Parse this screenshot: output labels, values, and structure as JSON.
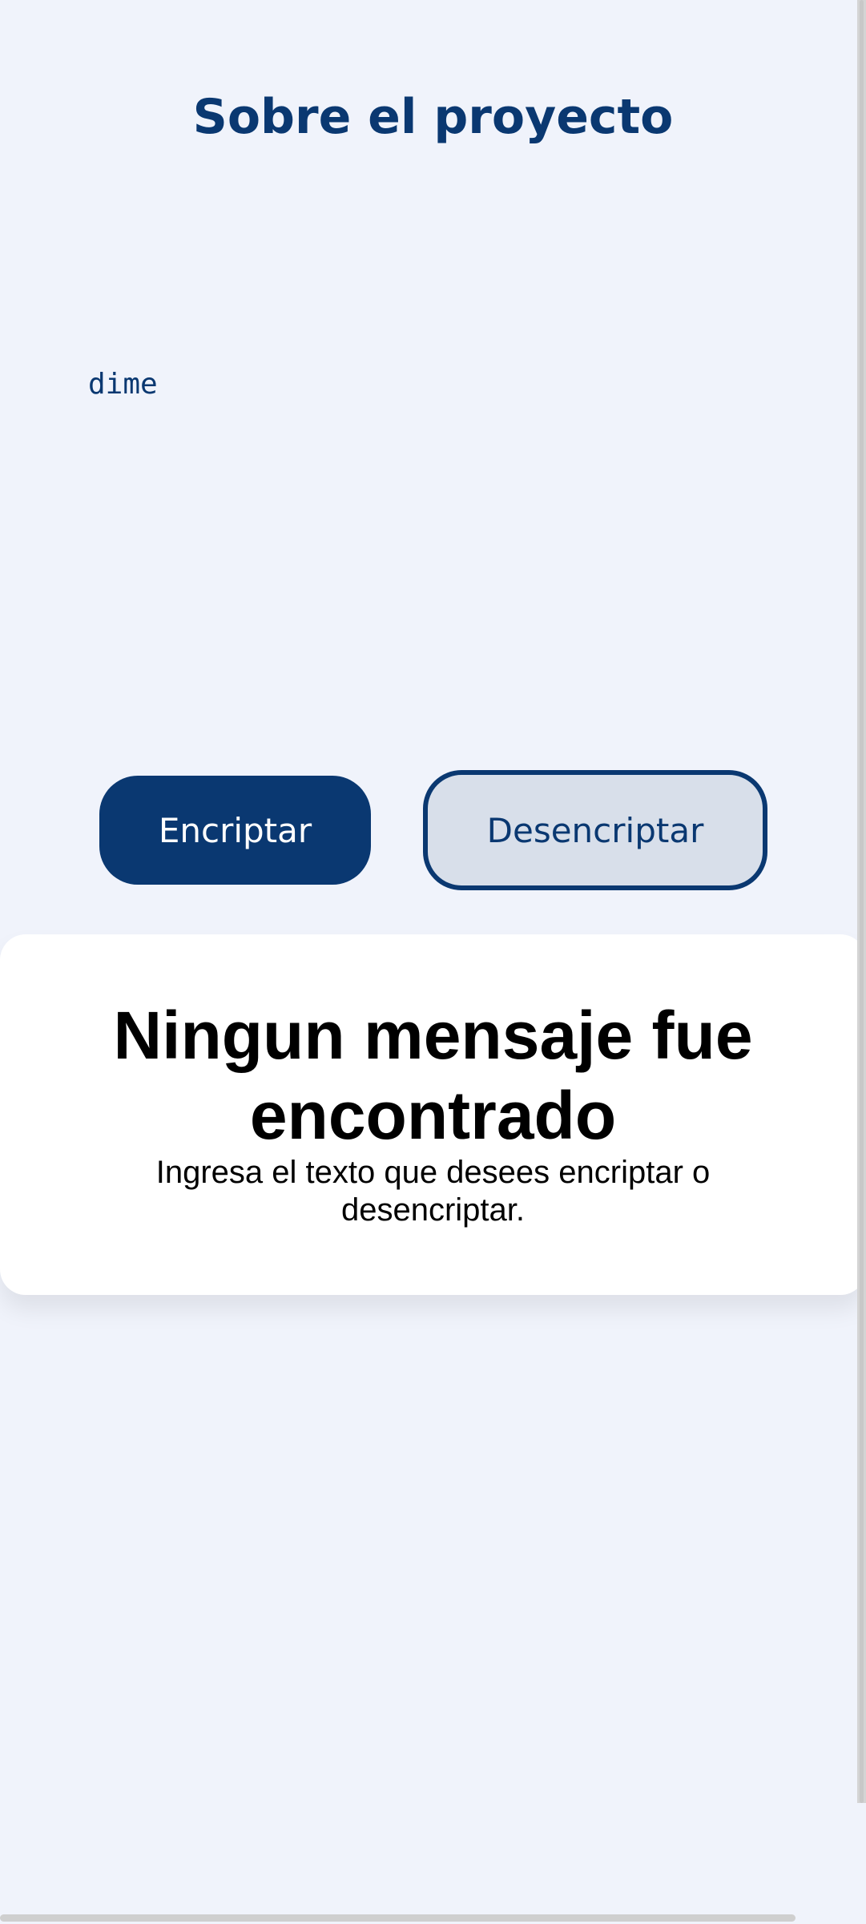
{
  "header": {
    "title": "Sobre el proyecto"
  },
  "input": {
    "value": "dime"
  },
  "actions": {
    "encrypt_label": "Encriptar",
    "decrypt_label": "Desencriptar"
  },
  "result": {
    "title": "Ningun mensaje fue encontrado",
    "text": "Ingresa el texto que desees encriptar o desencriptar."
  },
  "colors": {
    "background": "#f0f3fb",
    "primary": "#0a3871",
    "secondary_button_bg": "#d8dfea",
    "card": "#ffffff"
  }
}
